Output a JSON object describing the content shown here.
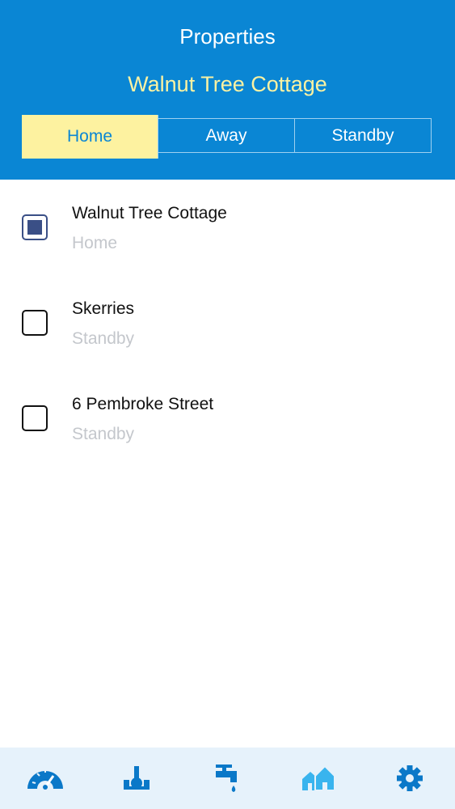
{
  "header": {
    "title": "Properties",
    "subtitle": "Walnut Tree Cottage",
    "modes": [
      {
        "label": "Home",
        "active": true
      },
      {
        "label": "Away",
        "active": false
      },
      {
        "label": "Standby",
        "active": false
      }
    ]
  },
  "properties": [
    {
      "name": "Walnut Tree Cottage",
      "status": "Home",
      "checked": true
    },
    {
      "name": "Skerries",
      "status": "Standby",
      "checked": false
    },
    {
      "name": "6 Pembroke Street",
      "status": "Standby",
      "checked": false
    }
  ],
  "tabbar": {
    "items": [
      {
        "icon": "gauge-icon",
        "active": false
      },
      {
        "icon": "valve-icon",
        "active": false
      },
      {
        "icon": "tap-icon",
        "active": false
      },
      {
        "icon": "houses-icon",
        "active": true
      },
      {
        "icon": "gear-icon",
        "active": false
      }
    ]
  },
  "colors": {
    "header_bg": "#0a86d4",
    "subtitle": "#fbf2a2",
    "active_segment_bg": "#fdf2a0",
    "checkbox_fill": "#3a4f86",
    "tab_icon": "#0a78c8",
    "tab_icon_active": "#39b4ee",
    "tabbar_bg": "#e6f2fb"
  }
}
